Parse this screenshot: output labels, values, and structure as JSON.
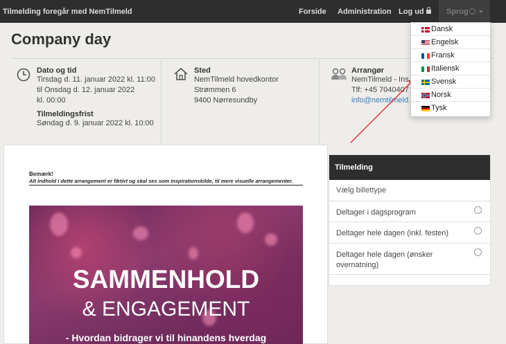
{
  "nav": {
    "brand": "Tilmelding foregår med NemTilmeld",
    "forside": "Forside",
    "administration": "Administration",
    "logud": "Log ud",
    "sprog": "Sprog"
  },
  "languages": [
    {
      "label": "Dansk",
      "flag": "dk-flag-icon"
    },
    {
      "label": "Engelsk",
      "flag": "us-flag-icon"
    },
    {
      "label": "Fransk",
      "flag": "fr-flag-icon"
    },
    {
      "label": "Italiensk",
      "flag": "it-flag-icon"
    },
    {
      "label": "Svensk",
      "flag": "se-flag-icon"
    },
    {
      "label": "Norsk",
      "flag": "no-flag-icon"
    },
    {
      "label": "Tysk",
      "flag": "de-flag-icon"
    }
  ],
  "event": {
    "title": "Company day",
    "date_label": "Dato og tid",
    "date_line1": "Tirsdag d. 11. januar 2022 kl. 11:00",
    "date_line2": "til Onsdag d. 12. januar 2022",
    "date_line3": "kl. 00:00",
    "deadline_label": "Tilmeldingsfrist",
    "deadline_value": "Søndag d. 9. januar 2022 kl. 10:00",
    "place_label": "Sted",
    "place_line1": "NemTilmeld hovedkontor",
    "place_line2": "Strømmen 6",
    "place_line3": "9400 Nørresundby",
    "organizer_label": "Arrangør",
    "organizer_line1": "NemTilmeld - Ins",
    "organizer_line2": "Tlf: +45 7040407",
    "organizer_line3": "info@nemtilmeld."
  },
  "content": {
    "note_title": "Bemærk!",
    "note_text": "Alt indhold i dette arrangement er fiktivt og skal ses som inspirationskilde, til mere visuelle arrangementer.",
    "hero_line1": "SAMMENHOLD",
    "hero_line2": "& ENGAGEMENT",
    "hero_line3": "- Hvordan bidrager vi til hinandens hverdag"
  },
  "registration": {
    "title": "Tilmelding",
    "subtitle": "Vælg billettype",
    "options": [
      "Deltager i dagsprogram",
      "Deltager hele dagen (inkl. festen)",
      "Deltager hele dagen (ønsker overnatning)"
    ]
  },
  "colors": {
    "navbar": "#2e2e2e",
    "link": "#3a7dbf",
    "annotation_arrow": "#e02020"
  }
}
